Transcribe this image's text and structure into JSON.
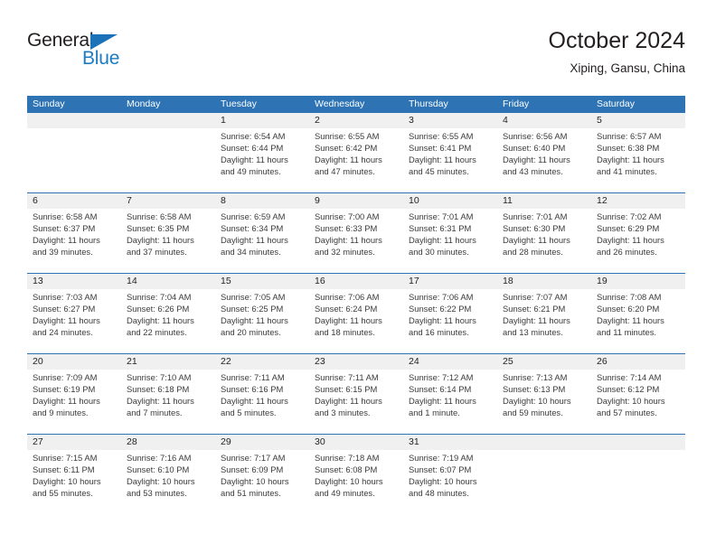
{
  "brand": {
    "name_top": "General",
    "name_bottom": "Blue",
    "accent_color": "#1b7cc4"
  },
  "header": {
    "title": "October 2024",
    "subtitle": "Xiping, Gansu, China"
  },
  "theme": {
    "header_blue": "#2e74b5",
    "daynum_band": "#f0f0f0",
    "text": "#231f20"
  },
  "weekdays": [
    "Sunday",
    "Monday",
    "Tuesday",
    "Wednesday",
    "Thursday",
    "Friday",
    "Saturday"
  ],
  "weeks": [
    [
      {
        "day": "",
        "lines": []
      },
      {
        "day": "",
        "lines": []
      },
      {
        "day": "1",
        "lines": [
          "Sunrise: 6:54 AM",
          "Sunset: 6:44 PM",
          "Daylight: 11 hours",
          "and 49 minutes."
        ]
      },
      {
        "day": "2",
        "lines": [
          "Sunrise: 6:55 AM",
          "Sunset: 6:42 PM",
          "Daylight: 11 hours",
          "and 47 minutes."
        ]
      },
      {
        "day": "3",
        "lines": [
          "Sunrise: 6:55 AM",
          "Sunset: 6:41 PM",
          "Daylight: 11 hours",
          "and 45 minutes."
        ]
      },
      {
        "day": "4",
        "lines": [
          "Sunrise: 6:56 AM",
          "Sunset: 6:40 PM",
          "Daylight: 11 hours",
          "and 43 minutes."
        ]
      },
      {
        "day": "5",
        "lines": [
          "Sunrise: 6:57 AM",
          "Sunset: 6:38 PM",
          "Daylight: 11 hours",
          "and 41 minutes."
        ]
      }
    ],
    [
      {
        "day": "6",
        "lines": [
          "Sunrise: 6:58 AM",
          "Sunset: 6:37 PM",
          "Daylight: 11 hours",
          "and 39 minutes."
        ]
      },
      {
        "day": "7",
        "lines": [
          "Sunrise: 6:58 AM",
          "Sunset: 6:35 PM",
          "Daylight: 11 hours",
          "and 37 minutes."
        ]
      },
      {
        "day": "8",
        "lines": [
          "Sunrise: 6:59 AM",
          "Sunset: 6:34 PM",
          "Daylight: 11 hours",
          "and 34 minutes."
        ]
      },
      {
        "day": "9",
        "lines": [
          "Sunrise: 7:00 AM",
          "Sunset: 6:33 PM",
          "Daylight: 11 hours",
          "and 32 minutes."
        ]
      },
      {
        "day": "10",
        "lines": [
          "Sunrise: 7:01 AM",
          "Sunset: 6:31 PM",
          "Daylight: 11 hours",
          "and 30 minutes."
        ]
      },
      {
        "day": "11",
        "lines": [
          "Sunrise: 7:01 AM",
          "Sunset: 6:30 PM",
          "Daylight: 11 hours",
          "and 28 minutes."
        ]
      },
      {
        "day": "12",
        "lines": [
          "Sunrise: 7:02 AM",
          "Sunset: 6:29 PM",
          "Daylight: 11 hours",
          "and 26 minutes."
        ]
      }
    ],
    [
      {
        "day": "13",
        "lines": [
          "Sunrise: 7:03 AM",
          "Sunset: 6:27 PM",
          "Daylight: 11 hours",
          "and 24 minutes."
        ]
      },
      {
        "day": "14",
        "lines": [
          "Sunrise: 7:04 AM",
          "Sunset: 6:26 PM",
          "Daylight: 11 hours",
          "and 22 minutes."
        ]
      },
      {
        "day": "15",
        "lines": [
          "Sunrise: 7:05 AM",
          "Sunset: 6:25 PM",
          "Daylight: 11 hours",
          "and 20 minutes."
        ]
      },
      {
        "day": "16",
        "lines": [
          "Sunrise: 7:06 AM",
          "Sunset: 6:24 PM",
          "Daylight: 11 hours",
          "and 18 minutes."
        ]
      },
      {
        "day": "17",
        "lines": [
          "Sunrise: 7:06 AM",
          "Sunset: 6:22 PM",
          "Daylight: 11 hours",
          "and 16 minutes."
        ]
      },
      {
        "day": "18",
        "lines": [
          "Sunrise: 7:07 AM",
          "Sunset: 6:21 PM",
          "Daylight: 11 hours",
          "and 13 minutes."
        ]
      },
      {
        "day": "19",
        "lines": [
          "Sunrise: 7:08 AM",
          "Sunset: 6:20 PM",
          "Daylight: 11 hours",
          "and 11 minutes."
        ]
      }
    ],
    [
      {
        "day": "20",
        "lines": [
          "Sunrise: 7:09 AM",
          "Sunset: 6:19 PM",
          "Daylight: 11 hours",
          "and 9 minutes."
        ]
      },
      {
        "day": "21",
        "lines": [
          "Sunrise: 7:10 AM",
          "Sunset: 6:18 PM",
          "Daylight: 11 hours",
          "and 7 minutes."
        ]
      },
      {
        "day": "22",
        "lines": [
          "Sunrise: 7:11 AM",
          "Sunset: 6:16 PM",
          "Daylight: 11 hours",
          "and 5 minutes."
        ]
      },
      {
        "day": "23",
        "lines": [
          "Sunrise: 7:11 AM",
          "Sunset: 6:15 PM",
          "Daylight: 11 hours",
          "and 3 minutes."
        ]
      },
      {
        "day": "24",
        "lines": [
          "Sunrise: 7:12 AM",
          "Sunset: 6:14 PM",
          "Daylight: 11 hours",
          "and 1 minute."
        ]
      },
      {
        "day": "25",
        "lines": [
          "Sunrise: 7:13 AM",
          "Sunset: 6:13 PM",
          "Daylight: 10 hours",
          "and 59 minutes."
        ]
      },
      {
        "day": "26",
        "lines": [
          "Sunrise: 7:14 AM",
          "Sunset: 6:12 PM",
          "Daylight: 10 hours",
          "and 57 minutes."
        ]
      }
    ],
    [
      {
        "day": "27",
        "lines": [
          "Sunrise: 7:15 AM",
          "Sunset: 6:11 PM",
          "Daylight: 10 hours",
          "and 55 minutes."
        ]
      },
      {
        "day": "28",
        "lines": [
          "Sunrise: 7:16 AM",
          "Sunset: 6:10 PM",
          "Daylight: 10 hours",
          "and 53 minutes."
        ]
      },
      {
        "day": "29",
        "lines": [
          "Sunrise: 7:17 AM",
          "Sunset: 6:09 PM",
          "Daylight: 10 hours",
          "and 51 minutes."
        ]
      },
      {
        "day": "30",
        "lines": [
          "Sunrise: 7:18 AM",
          "Sunset: 6:08 PM",
          "Daylight: 10 hours",
          "and 49 minutes."
        ]
      },
      {
        "day": "31",
        "lines": [
          "Sunrise: 7:19 AM",
          "Sunset: 6:07 PM",
          "Daylight: 10 hours",
          "and 48 minutes."
        ]
      },
      {
        "day": "",
        "lines": []
      },
      {
        "day": "",
        "lines": []
      }
    ]
  ]
}
